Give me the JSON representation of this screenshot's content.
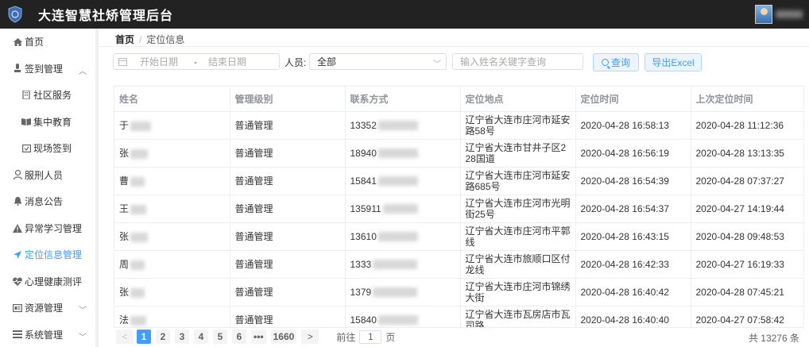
{
  "app": {
    "title": "大连智慧社矫管理后台"
  },
  "sidebar": {
    "items": [
      {
        "label": "首页",
        "icon": "home-icon"
      },
      {
        "label": "签到管理",
        "icon": "sign-in-icon"
      },
      {
        "label": "社区服务",
        "icon": "building-icon"
      },
      {
        "label": "集中教育",
        "icon": "book-icon"
      },
      {
        "label": "现场签到",
        "icon": "calendar-check-icon"
      },
      {
        "label": "服刑人员",
        "icon": "person-icon"
      },
      {
        "label": "消息公告",
        "icon": "bell-icon"
      },
      {
        "label": "异常学习管理",
        "icon": "warning-icon"
      },
      {
        "label": "定位信息管理",
        "icon": "location-arrow-icon"
      },
      {
        "label": "心理健康测评",
        "icon": "heartbeat-icon"
      },
      {
        "label": "资源管理",
        "icon": "resource-icon"
      },
      {
        "label": "系统管理",
        "icon": "system-icon"
      }
    ]
  },
  "breadcrumb": {
    "home": "首页",
    "separator": "/",
    "current": "定位信息"
  },
  "filters": {
    "start_placeholder": "开始日期",
    "range_separator": "-",
    "end_placeholder": "结束日期",
    "person_label": "人员:",
    "person_value": "全部",
    "name_placeholder": "输入姓名关键字查询",
    "query_label": "查询",
    "export_label": "导出Excel"
  },
  "table": {
    "columns": [
      "姓名",
      "管理级别",
      "联系方式",
      "定位地点",
      "定位时间",
      "上次定位时间"
    ],
    "rows": [
      {
        "name": "于",
        "level": "普通管理",
        "phone": "13352",
        "address": "辽宁省大连市庄河市延安路58号",
        "time": "2020-04-28 16:58:13",
        "last_time": "2020-04-28 11:12:36"
      },
      {
        "name": "张",
        "level": "普通管理",
        "phone": "18940",
        "address": "辽宁省大连市甘井子区228国道",
        "time": "2020-04-28 16:56:19",
        "last_time": "2020-04-28 13:13:35"
      },
      {
        "name": "曹",
        "level": "普通管理",
        "phone": "15841",
        "address": "辽宁省大连市庄河市延安路685号",
        "time": "2020-04-28 16:54:39",
        "last_time": "2020-04-28 07:37:27"
      },
      {
        "name": "王",
        "level": "普通管理",
        "phone": "135911",
        "address": "辽宁省大连市庄河市光明街25号",
        "time": "2020-04-28 16:54:37",
        "last_time": "2020-04-27 14:19:44"
      },
      {
        "name": "张",
        "level": "普通管理",
        "phone": "13610",
        "address": "辽宁省大连市庄河市平郭线",
        "time": "2020-04-28 16:43:15",
        "last_time": "2020-04-28 09:48:53"
      },
      {
        "name": "周",
        "level": "普通管理",
        "phone": "1333",
        "address": "辽宁省大连市旅顺口区付龙线",
        "time": "2020-04-28 16:42:33",
        "last_time": "2020-04-27 16:19:33"
      },
      {
        "name": "张",
        "level": "普通管理",
        "phone": "1379",
        "address": "辽宁省大连市庄河市锦绣大街",
        "time": "2020-04-28 16:40:42",
        "last_time": "2020-04-28 07:45:21"
      },
      {
        "name": "法",
        "level": "普通管理",
        "phone": "15840",
        "address": "辽宁省大连市瓦房店市瓦司路",
        "time": "2020-04-28 16:40:40",
        "last_time": "2020-04-27 07:58:42"
      }
    ]
  },
  "pagination": {
    "prev": "<",
    "pages": [
      "1",
      "2",
      "3",
      "4",
      "5",
      "6",
      "•••",
      "1660"
    ],
    "current": "1",
    "next": ">",
    "goto_prefix": "前往",
    "goto_value": "1",
    "goto_suffix": "页",
    "total": "共 13276 条"
  },
  "colors": {
    "topbar": "#222222",
    "accent": "#409eff"
  }
}
